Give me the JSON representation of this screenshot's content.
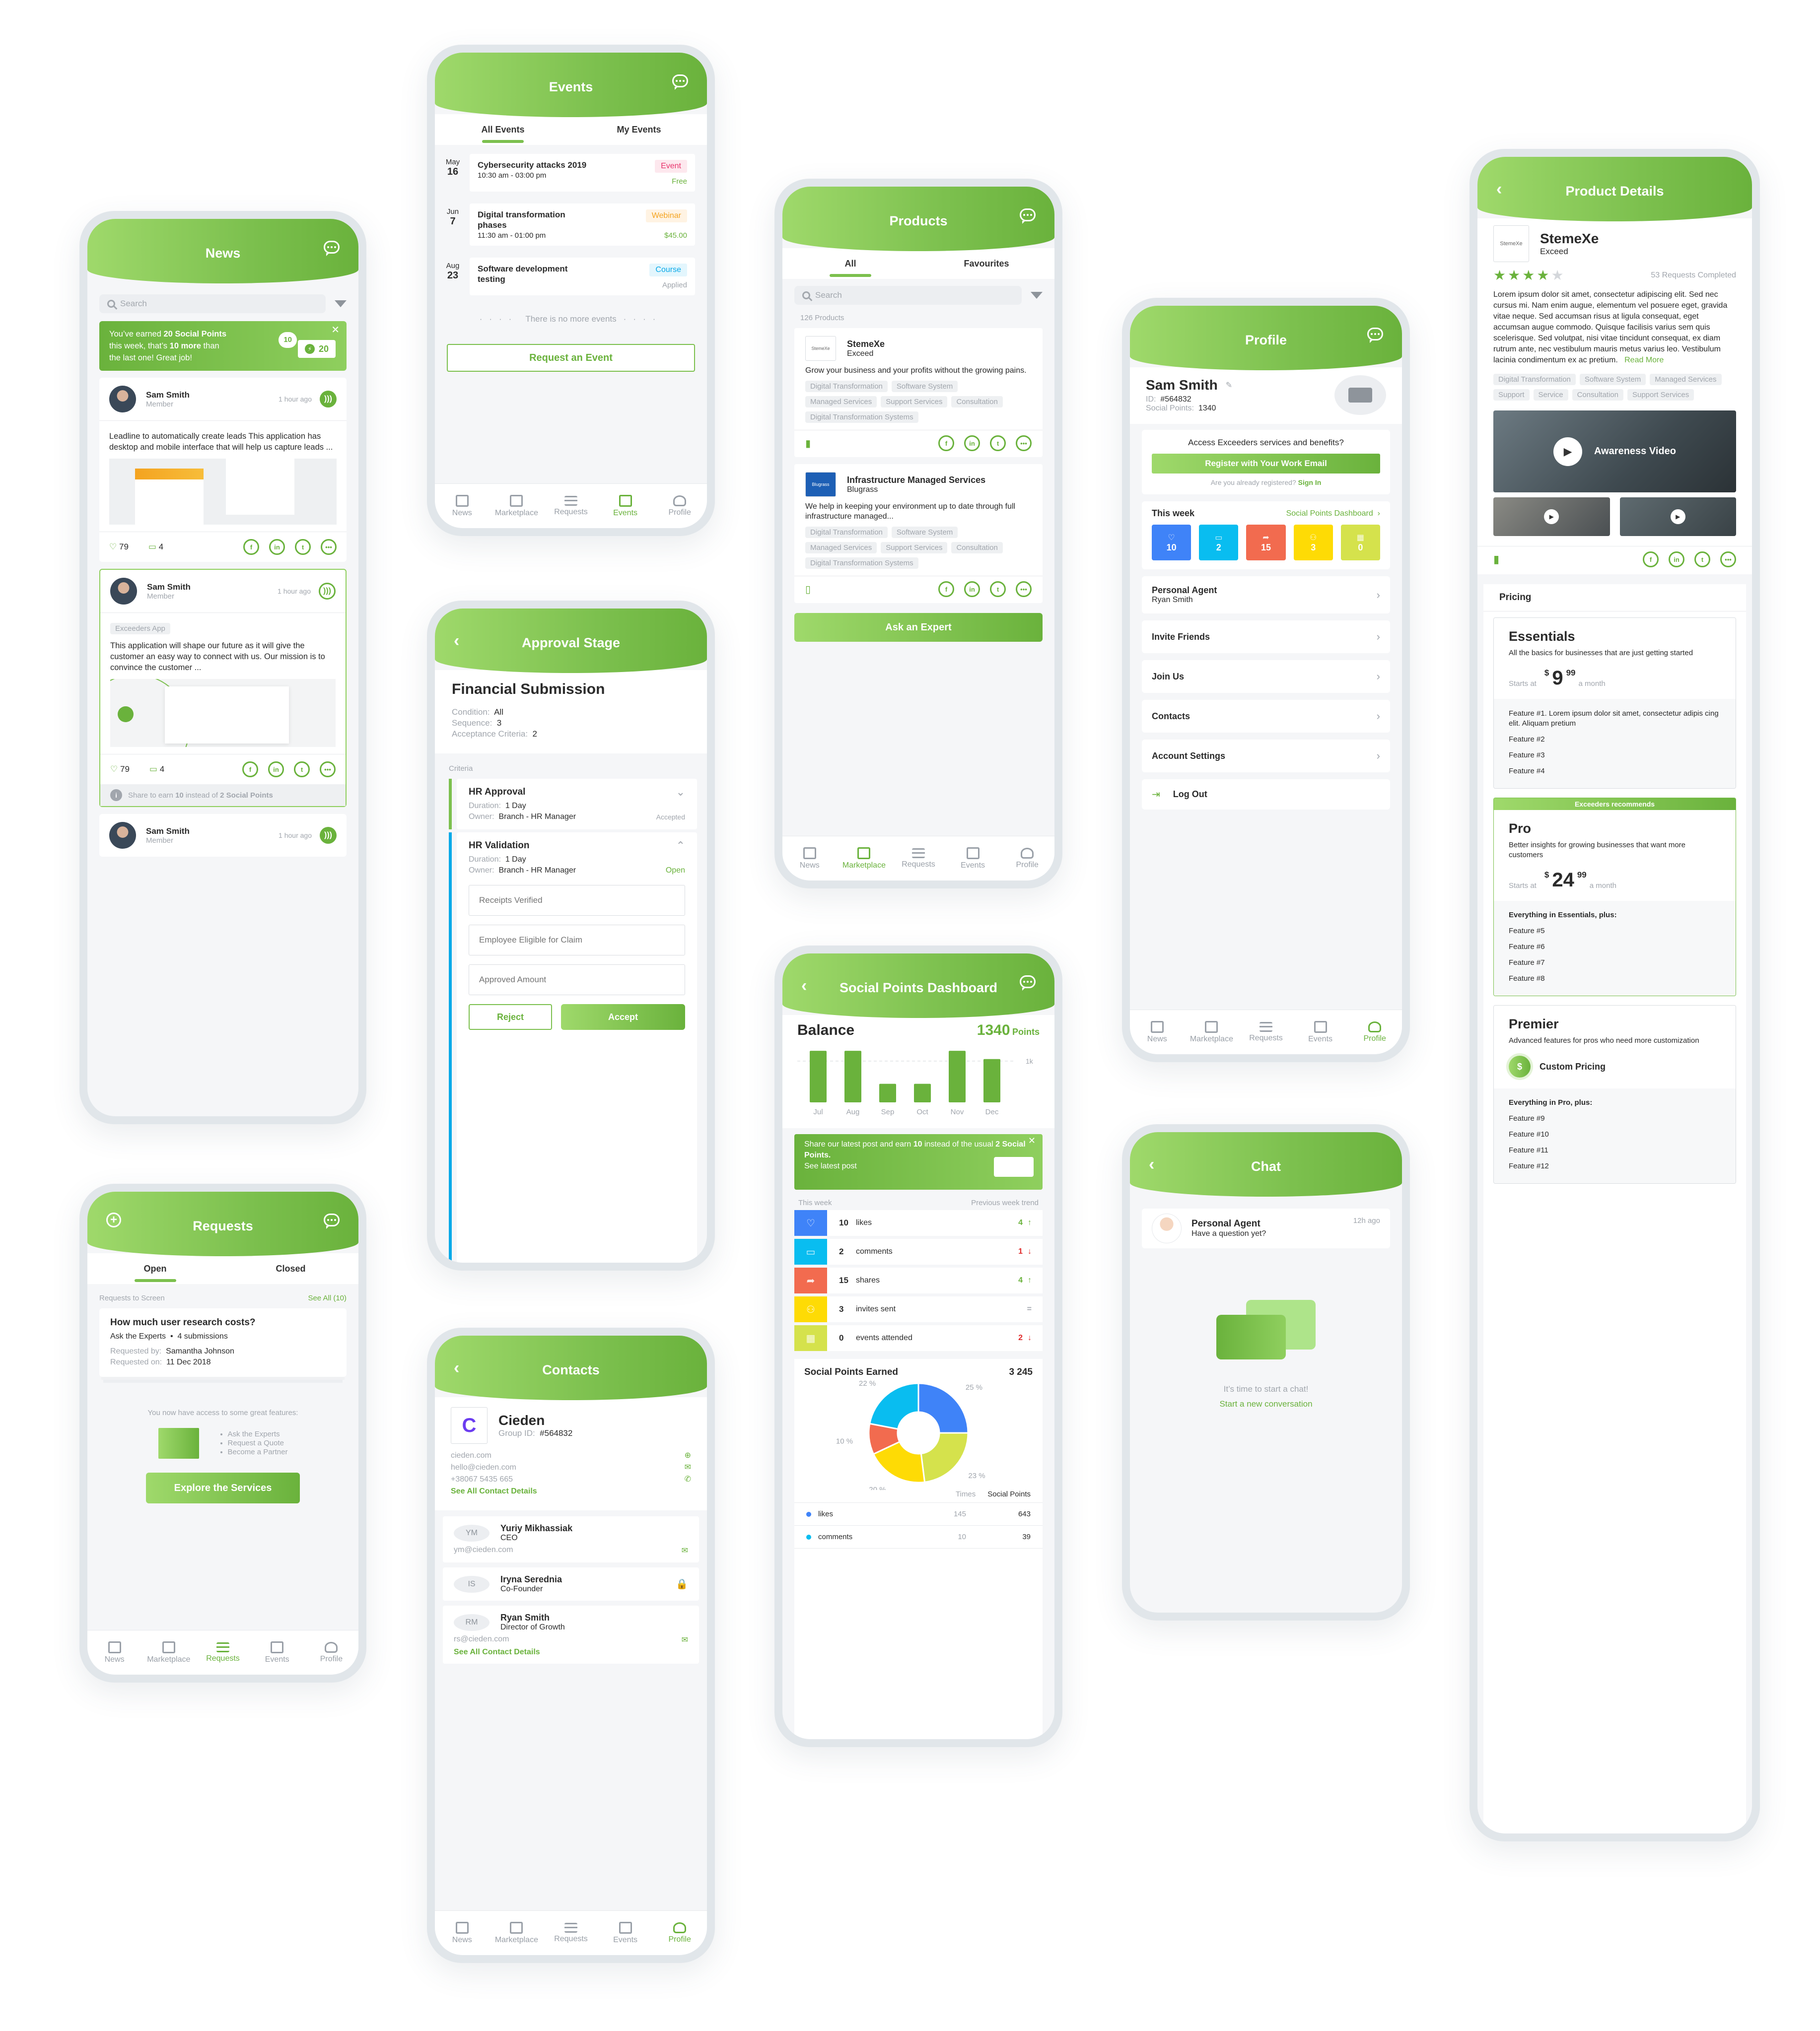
{
  "bottom_nav": [
    "News",
    "Marketplace",
    "Requests",
    "Events",
    "Profile"
  ],
  "news": {
    "title": "News",
    "search_placeholder": "Search",
    "banner": {
      "line1_pre": "You’ve earned ",
      "line1_bold": "20 Social Points",
      "line2_pre": "this week, that’s ",
      "line2_bold": "10 more",
      "line2_post": " than",
      "line3": "the last one! Great job!",
      "badge_small": "10",
      "badge_big": "20"
    },
    "posts": [
      {
        "author": "Sam Smith",
        "role": "Member",
        "time": "1 hour ago",
        "text": "Leadline to automatically create leads This application has desktop and mobile interface that will help us capture leads ...",
        "likes": "79",
        "comments": "4"
      },
      {
        "author": "Sam Smith",
        "role": "Member",
        "time": "1 hour ago",
        "tag": "Exceeders App",
        "text": "This application will shape our future as it will give the customer an easy way to connect with us. Our mission is to convince the customer ...",
        "likes": "79",
        "comments": "4",
        "hint_pre": "Share to earn ",
        "hint_bold1": "10",
        "hint_mid": " instead of ",
        "hint_bold2": "2 Social Points"
      },
      {
        "author": "Sam Smith",
        "role": "Member",
        "time": "1 hour ago"
      }
    ]
  },
  "events": {
    "title": "Events",
    "tabs": [
      "All Events",
      "My Events"
    ],
    "items": [
      {
        "month": "May",
        "day": "16",
        "title": "Cybersecurity attacks 2019",
        "time": "10:30 am - 03:00 pm",
        "badge": "Event",
        "price": "Free"
      },
      {
        "month": "Jun",
        "day": "7",
        "title": "Digital transformation phases",
        "time": "11:30 am - 01:00 pm",
        "badge": "Webinar",
        "price": "$45.00"
      },
      {
        "month": "Aug",
        "day": "23",
        "title": "Software development testing",
        "time": "",
        "badge": "Course",
        "price": "Applied"
      }
    ],
    "end_text": "There is no more events",
    "cta": "Request an Event"
  },
  "approval": {
    "title": "Approval Stage",
    "heading": "Financial Submission",
    "condition_label": "Condition:",
    "condition": "All",
    "sequence_label": "Sequence:",
    "sequence": "3",
    "criteria_label": "Acceptance Criteria:",
    "criteria": "2",
    "section": "Criteria",
    "items": [
      {
        "name": "HR Approval",
        "duration_label": "Duration:",
        "duration": "1 Day",
        "owner_label": "Owner:",
        "owner": "Branch - HR Manager",
        "status": "Accepted"
      },
      {
        "name": "HR Validation",
        "duration_label": "Duration:",
        "duration": "1 Day",
        "owner_label": "Owner:",
        "owner": "Branch - HR Manager",
        "status": "Open"
      }
    ],
    "fields": [
      "Receipts Verified",
      "Employee Eligible for Claim",
      "Approved Amount"
    ],
    "reject": "Reject",
    "accept": "Accept"
  },
  "requests": {
    "title": "Requests",
    "tabs": [
      "Open",
      "Closed"
    ],
    "section": "Requests to Screen",
    "see_all": "See All (10)",
    "card": {
      "title": "How much user research costs?",
      "category": "Ask the Experts",
      "submissions": "4 submissions",
      "by_label": "Requested by:",
      "by": "Samantha Johnson",
      "on_label": "Requested on:",
      "on": "11 Dec 2018"
    },
    "access_text": "You now have access to some great features:",
    "features": [
      "Ask the Experts",
      "Request a Quote",
      "Become a Partner"
    ],
    "cta": "Explore the Services"
  },
  "contacts": {
    "title": "Contacts",
    "company": "Cieden",
    "group_label": "Group ID:",
    "group_id": "#564832",
    "website": "cieden.com",
    "email": "hello@cieden.com",
    "phone": "+38067 5435 665",
    "see_all": "See All Contact Details",
    "people": [
      {
        "initials": "YM",
        "name": "Yuriy Mikhassiak",
        "role": "CEO",
        "email": "ym@cieden.com",
        "locked": false
      },
      {
        "initials": "IS",
        "name": "Iryna Serednia",
        "role": "Co-Founder",
        "email": "",
        "locked": true
      },
      {
        "initials": "RM",
        "name": "Ryan Smith",
        "role": "Director of Growth",
        "email": "rs@cieden.com",
        "locked": false
      }
    ]
  },
  "products": {
    "title": "Products",
    "tabs": [
      "All",
      "Favourites"
    ],
    "search_placeholder": "Search",
    "count": "126 Products",
    "items": [
      {
        "logo": "StemeXe",
        "name": "StemeXe",
        "vendor": "Exceed",
        "desc": "Grow your business and your profits without the growing pains.",
        "tags": [
          "Digital Transformation",
          "Software System",
          "Managed Services",
          "Support Services",
          "Consultation",
          "Digital Transformation Systems"
        ],
        "bookmarked": true
      },
      {
        "logo": "Blugrass",
        "name": "Infrastructure Managed Services",
        "vendor": "Blugrass",
        "desc": "We help in keeping your environment up to date through full infrastructure managed...",
        "tags": [
          "Digital Transformation",
          "Software System",
          "Managed Services",
          "Support Services",
          "Consultation",
          "Digital Transformation Systems"
        ],
        "bookmarked": false
      }
    ],
    "cta": "Ask an Expert"
  },
  "social": {
    "title": "Social Points Dashboard",
    "balance_label": "Balance",
    "balance": "1340",
    "balance_unit": "Points",
    "banner": {
      "pre": "Share our latest post and earn ",
      "b1": "10",
      "mid": " instead of the usual ",
      "b2": "2 Social Points.",
      "link": "See latest post"
    },
    "week_label": "This week",
    "trend_label": "Previous week trend",
    "stats": [
      {
        "value": "10",
        "label": "likes",
        "trend": "4",
        "dir": "up",
        "color": "#3f83f8"
      },
      {
        "value": "2",
        "label": "comments",
        "trend": "1",
        "dir": "down",
        "color": "#09bdf0"
      },
      {
        "value": "15",
        "label": "shares",
        "trend": "4",
        "dir": "up",
        "color": "#f26b4f"
      },
      {
        "value": "3",
        "label": "invites sent",
        "trend": "=",
        "dir": "same",
        "color": "#fedb05"
      },
      {
        "value": "0",
        "label": "events attended",
        "trend": "2",
        "dir": "down",
        "color": "#d5e24c"
      }
    ],
    "earned_label": "Social Points Earned",
    "earned_total": "3 245",
    "table_headers": [
      "Times",
      "Social Points"
    ],
    "table_rows": [
      {
        "label": "likes",
        "times": "145",
        "points": "643",
        "color": "#3f83f8"
      },
      {
        "label": "comments",
        "times": "10",
        "points": "39",
        "color": "#09bdf0"
      }
    ]
  },
  "chart_data": [
    {
      "type": "bar",
      "title": "Balance",
      "categories": [
        "Jul",
        "Aug",
        "Sep",
        "Oct",
        "Nov",
        "Dec"
      ],
      "values": [
        1250,
        1250,
        450,
        450,
        1250,
        1050
      ],
      "reference_line": {
        "value": 1000,
        "label": "1k"
      },
      "ylim": [
        0,
        1300
      ],
      "color": "#6ab23c"
    },
    {
      "type": "pie",
      "title": "Social Points Earned",
      "donut": true,
      "slices": [
        {
          "label": "likes",
          "value": 25,
          "color": "#3f83f8"
        },
        {
          "label": "events attended",
          "value": 23,
          "color": "#d5e24c"
        },
        {
          "label": "invites sent",
          "value": 20,
          "color": "#fedb05"
        },
        {
          "label": "shares",
          "value": 10,
          "color": "#f26b4f"
        },
        {
          "label": "comments",
          "value": 22,
          "color": "#09bdf0"
        }
      ]
    }
  ],
  "profile": {
    "title": "Profile",
    "name": "Sam Smith",
    "id_label": "ID:",
    "id": "#564832",
    "points_label": "Social Points:",
    "points": "1340",
    "access_q": "Access Exceeders services and benefits?",
    "register": "Register with Your Work Email",
    "already": "Are you already registered?",
    "sign_in": "Sign In",
    "week_label": "This week",
    "dashboard_link": "Social Points Dashboard",
    "tiles": [
      {
        "value": "10",
        "icon": "heart",
        "color": "#3f83f8"
      },
      {
        "value": "2",
        "icon": "comment",
        "color": "#09bdf0"
      },
      {
        "value": "15",
        "icon": "share",
        "color": "#f26b4f"
      },
      {
        "value": "3",
        "icon": "invite",
        "color": "#fedb05"
      },
      {
        "value": "0",
        "icon": "calendar",
        "color": "#d5e24c"
      }
    ],
    "agent_label": "Personal Agent",
    "agent_name": "Ryan Smith",
    "menu": [
      "Invite Friends",
      "Join Us",
      "Contacts",
      "Account Settings"
    ],
    "logout": "Log Out"
  },
  "chat": {
    "title": "Chat",
    "agent": "Personal Agent",
    "message": "Have a question yet?",
    "time": "12h ago",
    "empty": "It’s time to start a chat!",
    "cta": "Start a new conversation"
  },
  "product_details": {
    "title": "Product Details",
    "logo": "StemeXe",
    "name": "StemeXe",
    "vendor": "Exceed",
    "rating": 4,
    "rating_max": 5,
    "completed": "53 Requests Completed",
    "description": "Lorem ipsum dolor sit amet, consectetur adipiscing elit. Sed nec cursus mi. Nam enim augue, elementum vel posuere eget, gravida vitae neque. Sed accumsan risus at ligula consequat, eget accumsan augue commodo. Quisque facilisis varius sem quis scelerisque. Sed volutpat, nisi vitae tincidunt consequat, ex diam rutrum ante, nec vestibulum mauris metus varius leo. Vestibulum lacinia condimentum ex ac pretium.",
    "read_more": "Read More",
    "tags": [
      "Digital Transformation",
      "Software System",
      "Managed Services",
      "Support",
      "Service",
      "Consultation",
      "Support Services"
    ],
    "video_label": "Awareness Video",
    "pricing_label": "Pricing",
    "plans": [
      {
        "name": "Essentials",
        "desc": "All the basics for businesses that are just getting started",
        "starts": "Starts at",
        "currency": "$",
        "price": "9",
        "cents": "99",
        "period": "a month",
        "features_header": "",
        "features": [
          "Feature #1. Lorem ipsum dolor sit amet, consectetur adipis cing elit. Aliquam pretium",
          "Feature #2",
          "Feature #3",
          "Feature #4"
        ]
      },
      {
        "name": "Pro",
        "ribbon": "Exceeders recommends",
        "desc": "Better insights for growing businesses that want more customers",
        "starts": "Starts at",
        "currency": "$",
        "price": "24",
        "cents": "99",
        "period": "a month",
        "features_header": "Everything in Essentials, plus:",
        "features": [
          "Feature #5",
          "Feature #6",
          "Feature #7",
          "Feature #8"
        ]
      },
      {
        "name": "Premier",
        "desc": "Advanced features for pros who need more customization",
        "custom": "Custom Pricing",
        "features_header": "Everything in Pro, plus:",
        "features": [
          "Feature #9",
          "Feature #10",
          "Feature #11",
          "Feature #12"
        ]
      }
    ]
  }
}
